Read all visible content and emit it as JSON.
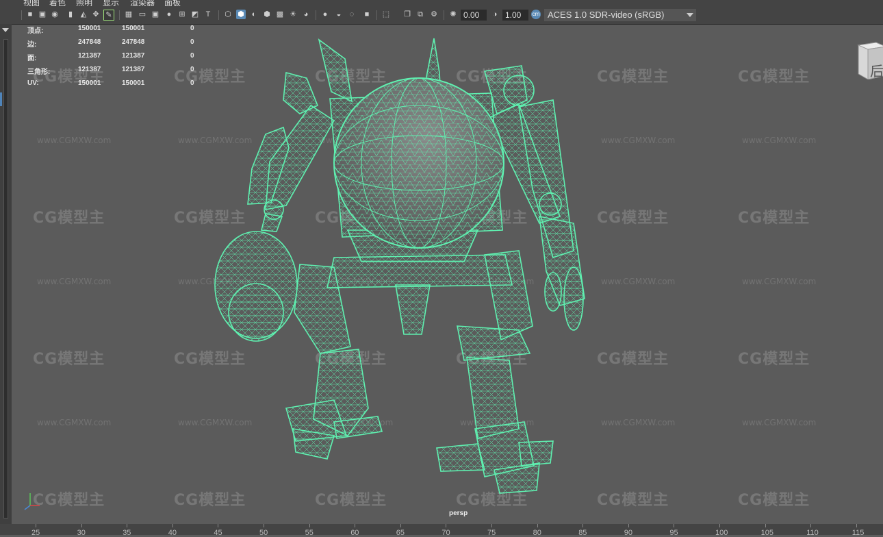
{
  "menu": [
    "视图",
    "着色",
    "照明",
    "显示",
    "渲染器",
    "面板"
  ],
  "toolbar": {
    "exposure": "0.00",
    "gamma": "1.00",
    "color_space": "ACES 1.0 SDR-video (sRGB)"
  },
  "stats": [
    {
      "label": "顶点:",
      "a": "150001",
      "b": "150001",
      "c": "0"
    },
    {
      "label": "边:",
      "a": "247848",
      "b": "247848",
      "c": "0"
    },
    {
      "label": "面:",
      "a": "121387",
      "b": "121387",
      "c": "0"
    },
    {
      "label": "三角形:",
      "a": "121387",
      "b": "121387",
      "c": "0"
    },
    {
      "label": "UV:",
      "a": "150001",
      "b": "150001",
      "c": "0"
    }
  ],
  "camera": "persp",
  "viewcube_face": "后",
  "watermark": {
    "logo": "CG模型主",
    "url": "www.CGMXW.com"
  },
  "ruler": [
    "25",
    "30",
    "35",
    "40",
    "45",
    "50",
    "55",
    "60",
    "65",
    "70",
    "75",
    "80",
    "85",
    "90",
    "95",
    "100",
    "105",
    "110",
    "115"
  ],
  "colors": {
    "wireframe": "#5ff0b0",
    "viewport": "#5b5b5b",
    "accent": "#5a8ab5"
  }
}
